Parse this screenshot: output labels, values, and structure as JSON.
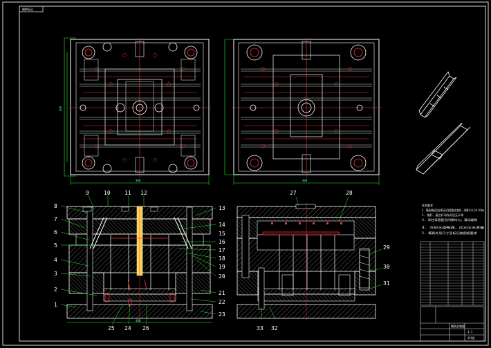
{
  "title_tab": "图样标记",
  "part_labels_left": [
    "1",
    "2",
    "3",
    "4",
    "5",
    "6",
    "7",
    "8",
    "9",
    "10",
    "11",
    "12"
  ],
  "part_labels_right": [
    "13",
    "14",
    "15",
    "16",
    "17",
    "18",
    "19",
    "20",
    "21",
    "22",
    "23"
  ],
  "part_labels_bottom": [
    "24",
    "25",
    "26"
  ],
  "part_labels_section2": [
    "27",
    "28",
    "29",
    "30",
    "31",
    "32",
    "33"
  ],
  "notes_heading": "技术要求",
  "notes": [
    "1. 模具装配后应保证分型面贴合良好，间隙不大于0.02mm",
    "2. 推杆、复位杆动作灵活无卡滞",
    "3. 导柱导套配合间隙均匀，滑动顺畅",
    "4. 冷却水道畅通，试水压无渗漏",
    "5. 模具外形尺寸及标记按图纸要求"
  ],
  "title_block": {
    "drawing_name": "模具总装图",
    "scale": "1:1",
    "sheet": "共1张"
  }
}
